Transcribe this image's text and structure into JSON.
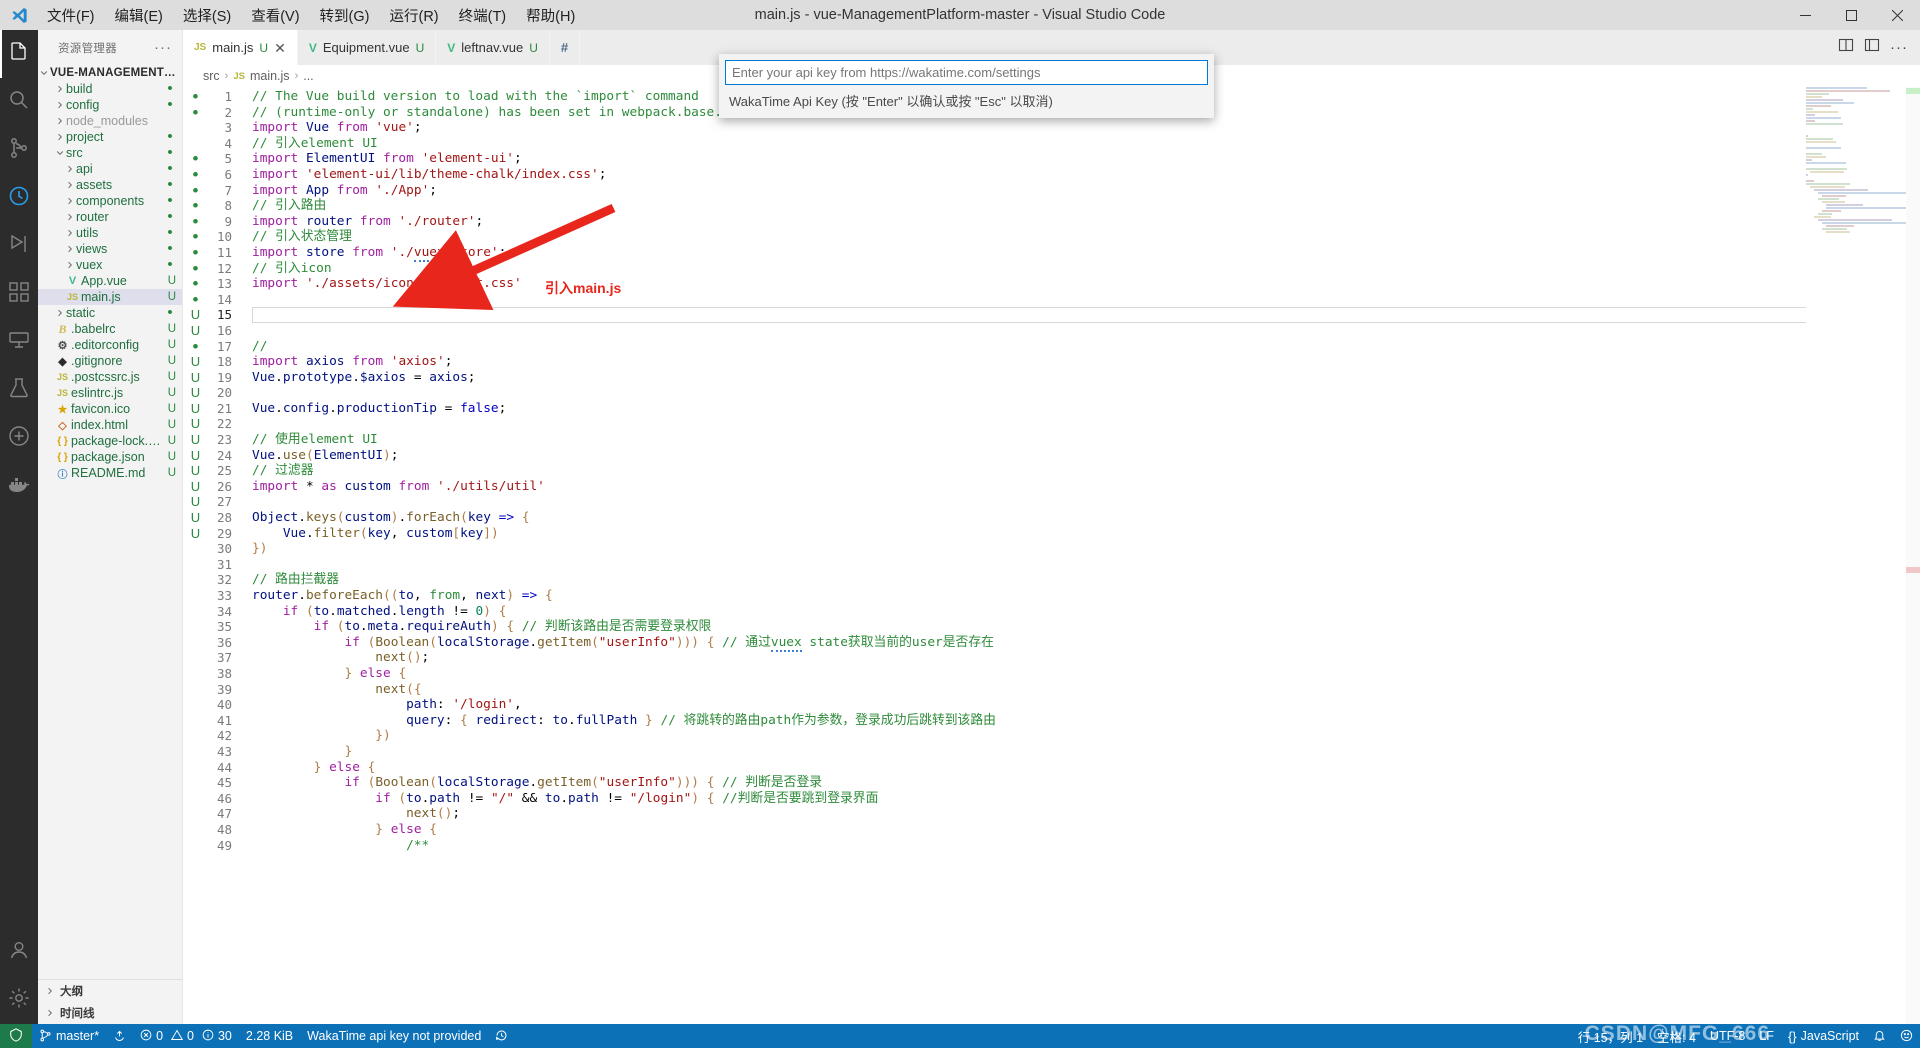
{
  "window": {
    "title": "main.js - vue-ManagementPlatform-master - Visual Studio Code",
    "minimize_label": "—",
    "maximize_label": "❐",
    "close_label": "✕"
  },
  "menu": {
    "items": [
      {
        "label": "文件(F)",
        "name": "menu-file"
      },
      {
        "label": "编辑(E)",
        "name": "menu-edit"
      },
      {
        "label": "选择(S)",
        "name": "menu-selection"
      },
      {
        "label": "查看(V)",
        "name": "menu-view"
      },
      {
        "label": "转到(G)",
        "name": "menu-go"
      },
      {
        "label": "运行(R)",
        "name": "menu-run"
      },
      {
        "label": "终端(T)",
        "name": "menu-terminal"
      },
      {
        "label": "帮助(H)",
        "name": "menu-help"
      }
    ]
  },
  "activitybar": {
    "items": [
      {
        "name": "explorer",
        "icon": "files-icon",
        "active": true
      },
      {
        "name": "search",
        "icon": "search-icon",
        "active": false
      },
      {
        "name": "source-control",
        "icon": "source-control-icon",
        "active": false
      },
      {
        "name": "wakatime",
        "icon": "clock-icon",
        "active": false
      },
      {
        "name": "run-debug",
        "icon": "run-debug-icon",
        "active": false
      },
      {
        "name": "extensions",
        "icon": "extensions-icon",
        "active": false
      },
      {
        "name": "remote-explorer",
        "icon": "remote-icon",
        "active": false
      },
      {
        "name": "test",
        "icon": "beaker-icon",
        "active": false
      },
      {
        "name": "live-share",
        "icon": "liveshare-icon",
        "active": false
      },
      {
        "name": "docker",
        "icon": "docker-icon",
        "active": false
      }
    ],
    "bottom": [
      {
        "name": "accounts",
        "icon": "account-icon"
      },
      {
        "name": "settings",
        "icon": "gear-icon"
      }
    ]
  },
  "sidebar": {
    "title": "资源管理器",
    "more_label": "···",
    "root": {
      "label": "VUE-MANAGEMENTPLATF...",
      "expanded": true
    },
    "tree": [
      {
        "label": "build",
        "indent": 1,
        "type": "folder",
        "expanded": false,
        "badge": "dot"
      },
      {
        "label": "config",
        "indent": 1,
        "type": "folder",
        "expanded": false,
        "badge": "dot"
      },
      {
        "label": "node_modules",
        "indent": 1,
        "type": "folder",
        "expanded": false,
        "badge": "",
        "dim": true
      },
      {
        "label": "project",
        "indent": 1,
        "type": "folder",
        "expanded": false,
        "badge": "dot"
      },
      {
        "label": "src",
        "indent": 1,
        "type": "folder",
        "expanded": true,
        "badge": "dot"
      },
      {
        "label": "api",
        "indent": 2,
        "type": "folder",
        "expanded": false,
        "badge": "dot"
      },
      {
        "label": "assets",
        "indent": 2,
        "type": "folder",
        "expanded": false,
        "badge": "dot"
      },
      {
        "label": "components",
        "indent": 2,
        "type": "folder",
        "expanded": false,
        "badge": "dot"
      },
      {
        "label": "router",
        "indent": 2,
        "type": "folder",
        "expanded": false,
        "badge": "dot"
      },
      {
        "label": "utils",
        "indent": 2,
        "type": "folder",
        "expanded": false,
        "badge": "dot"
      },
      {
        "label": "views",
        "indent": 2,
        "type": "folder",
        "expanded": false,
        "badge": "dot"
      },
      {
        "label": "vuex",
        "indent": 2,
        "type": "folder",
        "expanded": false,
        "badge": "dot"
      },
      {
        "label": "App.vue",
        "indent": 2,
        "type": "vue",
        "badge": "U"
      },
      {
        "label": "main.js",
        "indent": 2,
        "type": "js",
        "badge": "U",
        "selected": true
      },
      {
        "label": "static",
        "indent": 1,
        "type": "folder",
        "expanded": false,
        "badge": "dot"
      },
      {
        "label": ".babelrc",
        "indent": 1,
        "type": "babel",
        "badge": "U"
      },
      {
        "label": ".editorconfig",
        "indent": 1,
        "type": "gear",
        "badge": "U"
      },
      {
        "label": ".gitignore",
        "indent": 1,
        "type": "git",
        "badge": "U"
      },
      {
        "label": ".postcssrc.js",
        "indent": 1,
        "type": "js",
        "badge": "U"
      },
      {
        "label": "eslintrc.js",
        "indent": 1,
        "type": "js",
        "badge": "U"
      },
      {
        "label": "favicon.ico",
        "indent": 1,
        "type": "star",
        "badge": "U"
      },
      {
        "label": "index.html",
        "indent": 1,
        "type": "html",
        "badge": "U"
      },
      {
        "label": "package-lock.json",
        "indent": 1,
        "type": "json",
        "badge": "U"
      },
      {
        "label": "package.json",
        "indent": 1,
        "type": "json",
        "badge": "U"
      },
      {
        "label": "README.md",
        "indent": 1,
        "type": "md",
        "badge": "U"
      }
    ],
    "sections": [
      {
        "label": "大纲",
        "name": "outline-section"
      },
      {
        "label": "时间线",
        "name": "timeline-section"
      }
    ]
  },
  "tabs": [
    {
      "label": "main.js",
      "icon": "js",
      "badge": "U",
      "active": true,
      "closable": true
    },
    {
      "label": "Equipment.vue",
      "icon": "vue",
      "badge": "U",
      "active": false,
      "closable": false
    },
    {
      "label": "leftnav.vue",
      "icon": "vue",
      "badge": "U",
      "active": false,
      "closable": false
    },
    {
      "label": "",
      "icon": "hash",
      "badge": "",
      "active": false,
      "closable": false
    }
  ],
  "editor_actions": {
    "split_label": "split-editor-icon",
    "layout_label": "layout-icon",
    "more_label": "···"
  },
  "breadcrumb": {
    "parts": [
      "src",
      "main.js",
      "..."
    ],
    "sep": "›"
  },
  "quick_input": {
    "placeholder": "Enter your api key from https://wakatime.com/settings",
    "value": "",
    "description": "WakaTime Api Key (按 \"Enter\" 以确认或按 \"Esc\" 以取消)"
  },
  "annotation": {
    "text": "引入main.js",
    "color": "#e8261b"
  },
  "statusbar": {
    "remote_icon": "remote-icon",
    "branch": "master*",
    "sync_icon": "sync-icon",
    "errors": "0",
    "warnings": "0",
    "infos": "30",
    "filesize": "2.28 KiB",
    "wakatime": "WakaTime api key not provided",
    "history_icon": "history-icon",
    "cursor": "行 15，列 1",
    "indent": "空格: 4",
    "encoding": "UTF-8",
    "eol": "LF",
    "language": "JavaScript",
    "bell_icon": "bell-icon",
    "feedback_icon": "smiley-icon",
    "watermark": "CSDN@MFG_666"
  },
  "code": {
    "first_line": 1,
    "lines": [
      {
        "n": 1,
        "html": "<span class='cmt'>// The Vue build version to load with the `import` command</span>",
        "marker": "dot"
      },
      {
        "n": 2,
        "html": "<span class='cmt'>// (runtime-only or standalone) has been set in webpack.base.conf with an alias.</span>",
        "marker": "dot"
      },
      {
        "n": 3,
        "html": "<span class='kw'>import</span> <span class='id'>Vue</span> <span class='kw'>from</span> <span class='str'>'vue'</span>;",
        "marker": ""
      },
      {
        "n": 4,
        "html": "<span class='cmt'>// 引入element UI</span>",
        "marker": ""
      },
      {
        "n": 5,
        "html": "<span class='kw'>import</span> <span class='id'>ElementUI</span> <span class='kw'>from</span> <span class='str'>'element-ui'</span>;",
        "marker": "dot"
      },
      {
        "n": 6,
        "html": "<span class='kw'>import</span> <span class='str'>'element-ui/lib/theme-chalk/index.css'</span>;",
        "marker": "dot"
      },
      {
        "n": 7,
        "html": "<span class='kw'>import</span> <span class='id'>App</span> <span class='kw'>from</span> <span class='str'>'./App'</span>;",
        "marker": "dot"
      },
      {
        "n": 8,
        "html": "<span class='cmt'>// 引入路由</span>",
        "marker": "dot"
      },
      {
        "n": 9,
        "html": "<span class='kw'>import</span> <span class='id'>router</span> <span class='kw'>from</span> <span class='str'>'./router'</span>;",
        "marker": "dot"
      },
      {
        "n": 10,
        "html": "<span class='cmt'>// 引入状态管理</span>",
        "marker": "dot"
      },
      {
        "n": 11,
        "html": "<span class='kw'>import</span> <span class='id'>store</span> <span class='kw'>from</span> <span class='str'>'./<span class='squig'>vuex</span>/store'</span>;",
        "marker": "dot"
      },
      {
        "n": 12,
        "html": "<span class='cmt'>// 引入icon</span>",
        "marker": "dot"
      },
      {
        "n": 13,
        "html": "<span class='kw'>import</span> <span class='str'>'./assets/icon/iconfont.css'</span>",
        "marker": "dot"
      },
      {
        "n": 14,
        "html": "",
        "marker": "dot"
      },
      {
        "n": 15,
        "html": "",
        "marker": "U",
        "current": true
      },
      {
        "n": 16,
        "html": "",
        "marker": "U"
      },
      {
        "n": 17,
        "html": "<span class='cmt'>//</span>",
        "marker": "dot"
      },
      {
        "n": 18,
        "html": "<span class='kw'>import</span> <span class='id'>axios</span> <span class='kw'>from</span> <span class='str'>'axios'</span>;",
        "marker": "U"
      },
      {
        "n": 19,
        "html": "<span class='id'>Vue</span>.<span class='id'>prototype</span>.<span class='id'>$axios</span> = <span class='id'>axios</span>;",
        "marker": "U"
      },
      {
        "n": 20,
        "html": "",
        "marker": "U"
      },
      {
        "n": 21,
        "html": "<span class='id'>Vue</span>.<span class='id'>config</span>.<span class='id'>productionTip</span> = <span class='kw2'>false</span>;",
        "marker": "U"
      },
      {
        "n": 22,
        "html": "",
        "marker": "U"
      },
      {
        "n": 23,
        "html": "<span class='cmt'>// 使用element UI</span>",
        "marker": "U"
      },
      {
        "n": 24,
        "html": "<span class='id'>Vue</span>.<span class='fn'>use</span><span class='par'>(</span><span class='id'>ElementUI</span><span class='par'>)</span>;",
        "marker": "U"
      },
      {
        "n": 25,
        "html": "<span class='cmt'>// 过滤器</span>",
        "marker": "U"
      },
      {
        "n": 26,
        "html": "<span class='kw'>import</span> * <span class='kw'>as</span> <span class='id'>custom</span> <span class='kw'>from</span> <span class='str'>'./utils/util'</span>",
        "marker": "U"
      },
      {
        "n": 27,
        "html": "",
        "marker": "U"
      },
      {
        "n": 28,
        "html": "<span class='id'>Object</span>.<span class='fn'>keys</span><span class='par'>(</span><span class='id'>custom</span><span class='par'>)</span>.<span class='fn'>forEach</span><span class='par'>(</span><span class='id'>key</span> <span class='kw2'>=&gt;</span> <span class='par'>{</span>",
        "marker": "U"
      },
      {
        "n": 29,
        "html": "    <span class='id'>Vue</span>.<span class='fn'>filter</span><span class='par'>(</span><span class='id'>key</span>, <span class='id'>custom</span><span class='par'>[</span><span class='id'>key</span><span class='par'>]</span><span class='par'>)</span>",
        "marker": "U"
      },
      {
        "n": 30,
        "html": "<span class='par'>}</span><span class='par'>)</span>",
        "marker": ""
      },
      {
        "n": 31,
        "html": "",
        "marker": ""
      },
      {
        "n": 32,
        "html": "<span class='cmt'>// 路由拦截器</span>",
        "marker": ""
      },
      {
        "n": 33,
        "html": "<span class='id'>router</span>.<span class='fn'>beforeEach</span><span class='par'>(</span><span class='par'>(</span><span class='id'>to</span>, <span class='cmt'>from</span>, <span class='id'>next</span><span class='par'>)</span> <span class='kw2'>=&gt;</span> <span class='par'>{</span>",
        "marker": ""
      },
      {
        "n": 34,
        "html": "    <span class='kw'>if</span> <span class='par'>(</span><span class='id'>to</span>.<span class='id'>matched</span>.<span class='id'>length</span> != <span class='num'>0</span><span class='par'>)</span> <span class='par'>{</span>",
        "marker": ""
      },
      {
        "n": 35,
        "html": "        <span class='kw'>if</span> <span class='par'>(</span><span class='id'>to</span>.<span class='id'>meta</span>.<span class='id'>requireAuth</span><span class='par'>)</span> <span class='par'>{</span> <span class='cmt'>// 判断该路由是否需要登录权限</span>",
        "marker": ""
      },
      {
        "n": 36,
        "html": "            <span class='kw'>if</span> <span class='par'>(</span><span class='fn'>Boolean</span><span class='par'>(</span><span class='id'>localStorage</span>.<span class='fn'>getItem</span><span class='par'>(</span><span class='str'>\"userInfo\"</span><span class='par'>)</span><span class='par'>)</span><span class='par'>)</span> <span class='par'>{</span> <span class='cmt'>// 通过<span class='squig'>vuex</span> state获取当前的user是否存在</span>",
        "marker": ""
      },
      {
        "n": 37,
        "html": "                <span class='fn'>next</span><span class='par'>(</span><span class='par'>)</span>;",
        "marker": ""
      },
      {
        "n": 38,
        "html": "            <span class='par'>}</span> <span class='kw'>else</span> <span class='par'>{</span>",
        "marker": ""
      },
      {
        "n": 39,
        "html": "                <span class='fn'>next</span><span class='par'>(</span><span class='par'>{</span>",
        "marker": ""
      },
      {
        "n": 40,
        "html": "                    <span class='id'>path</span>: <span class='str'>'/login'</span>,",
        "marker": ""
      },
      {
        "n": 41,
        "html": "                    <span class='id'>query</span>: <span class='par'>{</span> <span class='id'>redirect</span>: <span class='id'>to</span>.<span class='id'>fullPath</span> <span class='par'>}</span> <span class='cmt'>// 将跳转的路由path作为参数，登录成功后跳转到该路由</span>",
        "marker": ""
      },
      {
        "n": 42,
        "html": "                <span class='par'>}</span><span class='par'>)</span>",
        "marker": ""
      },
      {
        "n": 43,
        "html": "            <span class='par'>}</span>",
        "marker": ""
      },
      {
        "n": 44,
        "html": "        <span class='par'>}</span> <span class='kw'>else</span> <span class='par'>{</span>",
        "marker": ""
      },
      {
        "n": 45,
        "html": "            <span class='kw'>if</span> <span class='par'>(</span><span class='fn'>Boolean</span><span class='par'>(</span><span class='id'>localStorage</span>.<span class='fn'>getItem</span><span class='par'>(</span><span class='str'>\"userInfo\"</span><span class='par'>)</span><span class='par'>)</span><span class='par'>)</span> <span class='par'>{</span> <span class='cmt'>// 判断是否登录</span>",
        "marker": ""
      },
      {
        "n": 46,
        "html": "                <span class='kw'>if</span> <span class='par'>(</span><span class='id'>to</span>.<span class='id'>path</span> != <span class='str'>\"/\"</span> &amp;&amp; <span class='id'>to</span>.<span class='id'>path</span> != <span class='str'>\"/login\"</span><span class='par'>)</span> <span class='par'>{</span> <span class='cmt'>//判断是否要跳到登录界面</span>",
        "marker": ""
      },
      {
        "n": 47,
        "html": "                    <span class='fn'>next</span><span class='par'>(</span><span class='par'>)</span>;",
        "marker": ""
      },
      {
        "n": 48,
        "html": "                <span class='par'>}</span> <span class='kw'>else</span> <span class='par'>{</span>",
        "marker": ""
      },
      {
        "n": 49,
        "html": "                    <span class='cmt'>/**</span>",
        "marker": ""
      }
    ]
  }
}
